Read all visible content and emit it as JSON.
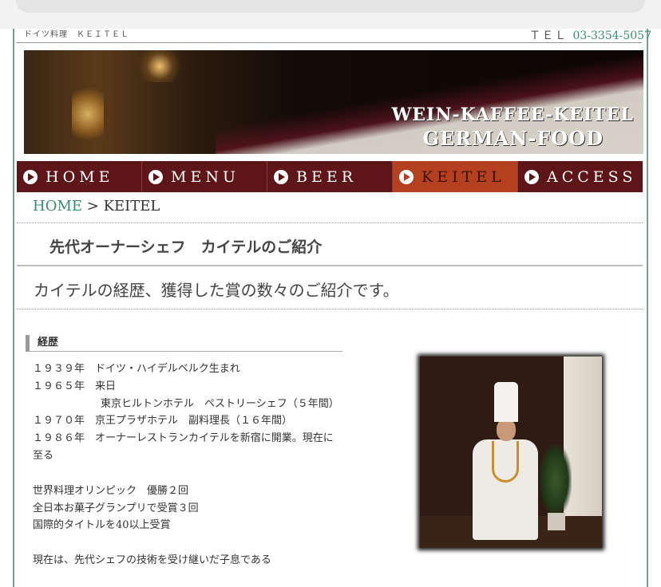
{
  "header": {
    "tagline": "ドイツ料理　ＫＥＩＴＥＬ",
    "tel_label": "ＴＥＬ",
    "tel_number": "03-3354-5057"
  },
  "banner": {
    "line1": "WEIN-KAFFEE-KEITEL",
    "line2": "GERMAN-FOOD"
  },
  "nav": {
    "items": [
      {
        "label": "HOME",
        "active": false
      },
      {
        "label": "MENU",
        "active": false
      },
      {
        "label": "BEER",
        "active": false
      },
      {
        "label": "KEITEL",
        "active": true
      },
      {
        "label": "ACCESS",
        "active": false
      }
    ]
  },
  "breadcrumb": {
    "home": "HOME",
    "separator": " > ",
    "current": "KEITEL"
  },
  "page": {
    "title": "先代オーナーシェフ　カイテルのご紹介",
    "lead": "カイテルの経歴、獲得した賞の数々のご紹介です。"
  },
  "bio": {
    "heading": "経歴",
    "lines": [
      "１９３９年　ドイツ・ハイデルベルク生まれ",
      "１９６５年　来日",
      "東京ヒルトンホテル　ペストリーシェフ（５年間）",
      "１９７０年　京王プラザホテル　副料理長（１６年間）",
      "１９８６年　オーナーレストランカイテルを新宿に開業。現在に至る",
      "世界料理オリンピック　優勝２回",
      "全日本お菓子グランプリで受賞３回",
      "国際的タイトルを40以上受賞",
      "現在は、先代シェフの技術を受け継いだ子息である"
    ]
  },
  "colors": {
    "nav_bg": "#5e1518",
    "nav_active": "#b44020",
    "link": "#3c8a74",
    "frame": "#7aa08d"
  }
}
